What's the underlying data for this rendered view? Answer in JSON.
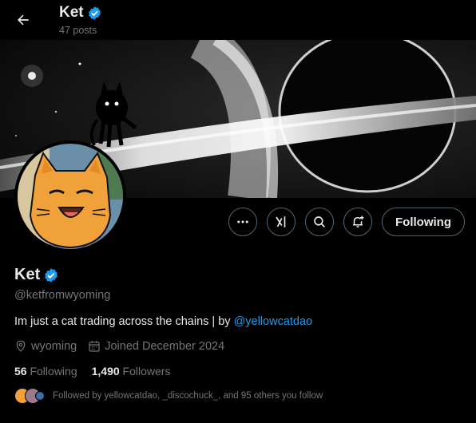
{
  "header": {
    "name": "Ket",
    "posts": "47 posts"
  },
  "profile": {
    "name": "Ket",
    "handle": "@ketfromwyoming",
    "bio_text": "Im just a cat trading across the chains | by ",
    "bio_link": "@yellowcatdao",
    "location": "wyoming",
    "joined": "Joined December 2024",
    "following_count": "56",
    "following_label": "Following",
    "followers_count": "1,490",
    "followers_label": "Followers",
    "followed_by": "Followed by yellowcatdao, _discochuck_, and 95 others you follow"
  },
  "actions": {
    "follow_label": "Following",
    "icons": [
      "more-icon",
      "grok-icon",
      "search-icon",
      "notify-icon"
    ]
  },
  "colors": {
    "accent": "#1d9bf0",
    "muted": "#71767b",
    "border": "#536471",
    "avatar_orange": "#f0a13a"
  }
}
